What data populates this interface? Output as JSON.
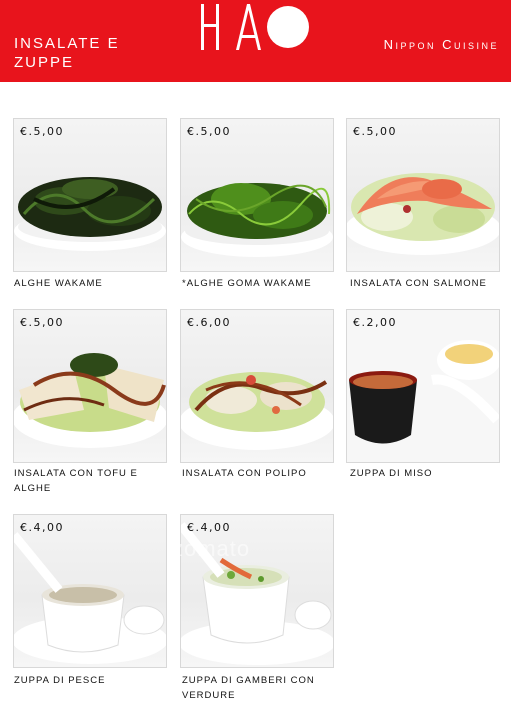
{
  "header": {
    "section_title": "Insalate e zuppe",
    "logo_text": "HAO",
    "subtitle": "Nippon Cuisine"
  },
  "colors": {
    "brand_red": "#e8141c"
  },
  "items": [
    {
      "price": "€.5,00",
      "name": "Alghe wakame"
    },
    {
      "price": "€.5,00",
      "name": "*Alghe goma wakame"
    },
    {
      "price": "€.5,00",
      "name": "Insalata con salmone"
    },
    {
      "price": "€.5,00",
      "name": "Insalata con tofu e alghe"
    },
    {
      "price": "€.6,00",
      "name": "Insalata con polipo"
    },
    {
      "price": "€.2,00",
      "name": "Zuppa di miso"
    },
    {
      "price": "€.4,00",
      "name": "Zuppa di pesce"
    },
    {
      "price": "€.4,00",
      "name": "Zuppa di gamberi con verdure"
    }
  ],
  "watermark": "zomato"
}
